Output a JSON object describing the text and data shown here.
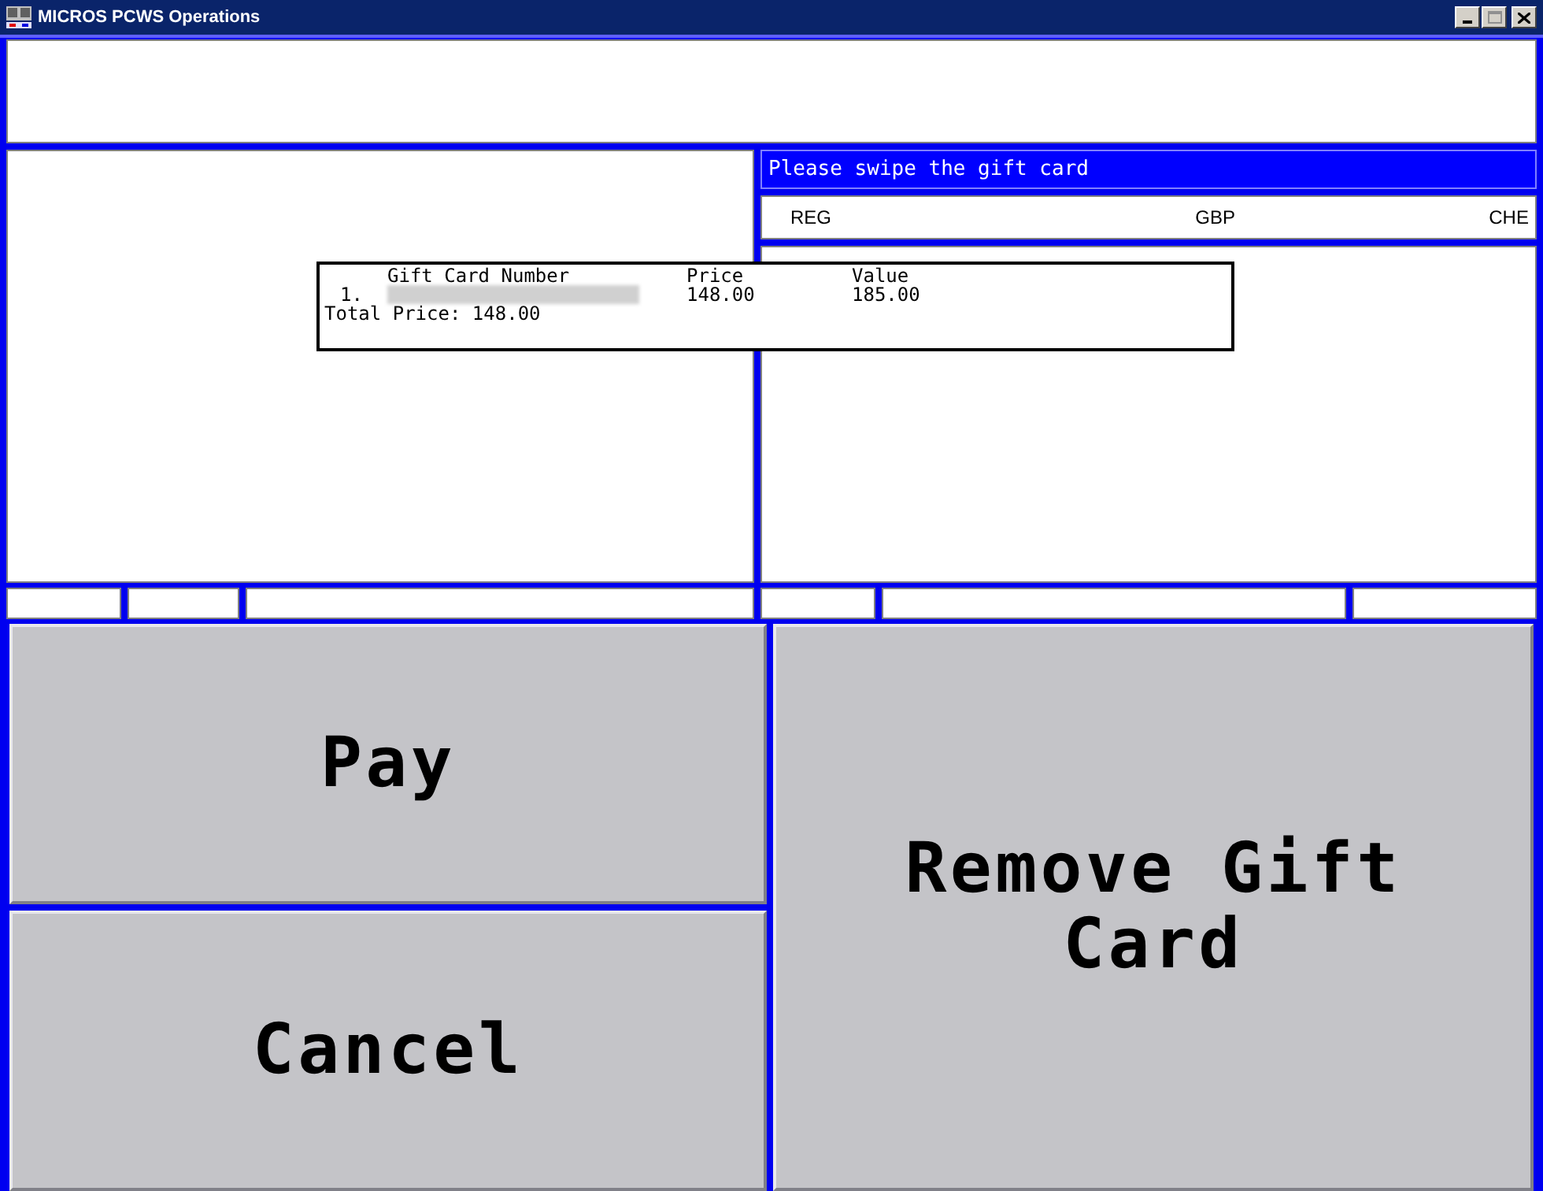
{
  "window": {
    "title": "MICROS PCWS Operations"
  },
  "prompt": "Please swipe the gift card",
  "header": {
    "left": "REG",
    "center": "GBP",
    "right": "CHE"
  },
  "popup": {
    "columns": [
      "Gift Card Number",
      "Price",
      "Value"
    ],
    "rows": [
      {
        "index": "1.",
        "number_redacted": true,
        "price": "148.00",
        "value": "185.00"
      }
    ],
    "total": "Total Price: 148.00"
  },
  "left_buttons": [
    {
      "label": "Pay"
    },
    {
      "label": "Cancel"
    }
  ],
  "right_buttons": [
    {
      "label": "Remove Gift Card"
    }
  ]
}
